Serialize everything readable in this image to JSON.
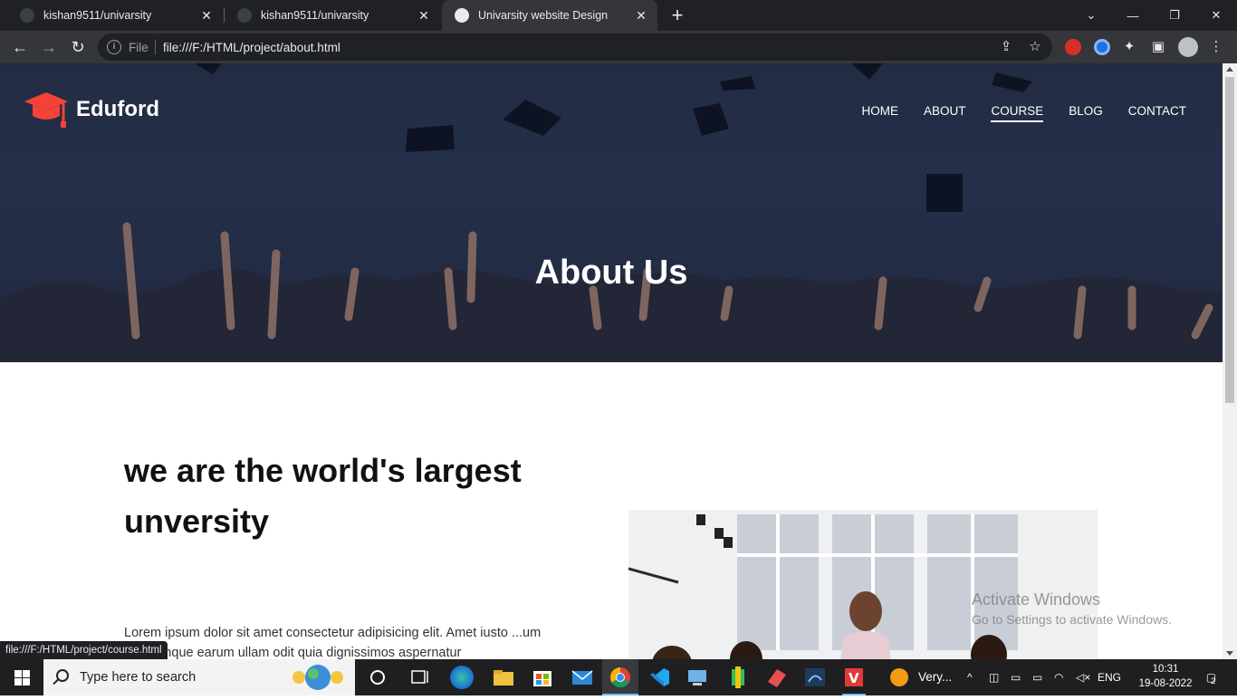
{
  "browser": {
    "tabs": [
      {
        "title": "kishan9511/univarsity",
        "active": false
      },
      {
        "title": "kishan9511/univarsity",
        "active": false
      },
      {
        "title": "Univarsity website Design",
        "active": true
      }
    ],
    "omnibox": {
      "scheme_label": "File",
      "url": "file:///F:/HTML/project/about.html"
    }
  },
  "site": {
    "brand": "Eduford",
    "nav": [
      {
        "label": "HOME",
        "current": false
      },
      {
        "label": "ABOUT",
        "current": false
      },
      {
        "label": "COURSE",
        "current": true
      },
      {
        "label": "BLOG",
        "current": false
      },
      {
        "label": "CONTACT",
        "current": false
      }
    ],
    "hero_title": "About Us",
    "about": {
      "heading": "we are the world's largest unversity",
      "text": "Lorem ipsum dolor sit amet consectetur adipisicing elit. Amet iusto ...um doloremque earum ullam odit quia dignissimos aspernatur"
    },
    "accent_color": "#f44336"
  },
  "status_bar": {
    "link": "file:///F:/HTML/project/course.html"
  },
  "watermark": {
    "line1": "Activate Windows",
    "line2": "Go to Settings to activate Windows."
  },
  "taskbar": {
    "search_placeholder": "Type here to search",
    "pinned_label": "Very...",
    "language": "ENG",
    "time": "10:31",
    "date": "19-08-2022",
    "notifications": "2"
  }
}
